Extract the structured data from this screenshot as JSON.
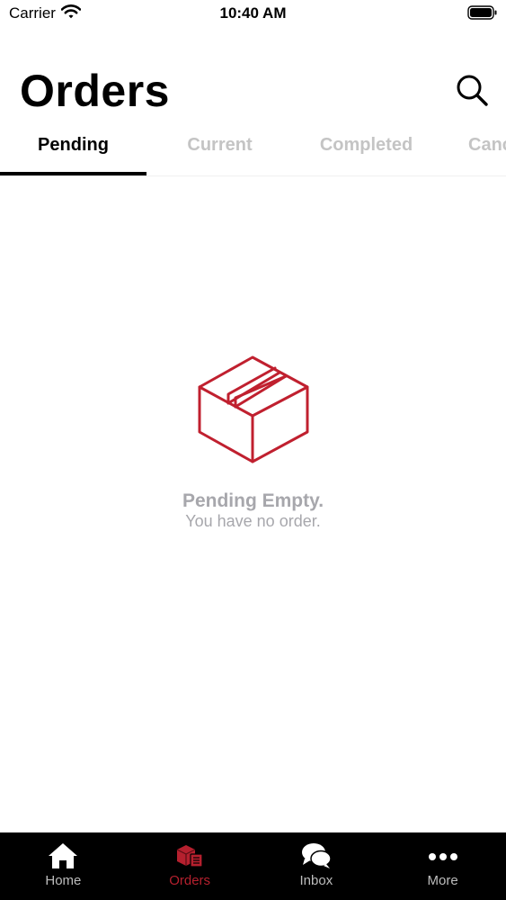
{
  "status_bar": {
    "carrier": "Carrier",
    "time": "10:40 AM"
  },
  "header": {
    "title": "Orders",
    "search_icon": "search-icon"
  },
  "tabs": [
    {
      "label": "Pending",
      "active": true
    },
    {
      "label": "Current",
      "active": false
    },
    {
      "label": "Completed",
      "active": false
    },
    {
      "label": "Cancelled",
      "active": false
    }
  ],
  "empty_state": {
    "icon": "box-icon",
    "title": "Pending Empty.",
    "subtitle": "You have no order."
  },
  "tab_bar": {
    "items": [
      {
        "label": "Home",
        "icon": "home-icon",
        "active": false
      },
      {
        "label": "Orders",
        "icon": "orders-icon",
        "active": true
      },
      {
        "label": "Inbox",
        "icon": "inbox-icon",
        "active": false
      },
      {
        "label": "More",
        "icon": "more-icon",
        "active": false
      }
    ]
  },
  "colors": {
    "accent": "#b5202e",
    "tab_bar_background": "#000000",
    "inactive_text": "#c4c4c4",
    "empty_text": "#a7a7ac"
  }
}
